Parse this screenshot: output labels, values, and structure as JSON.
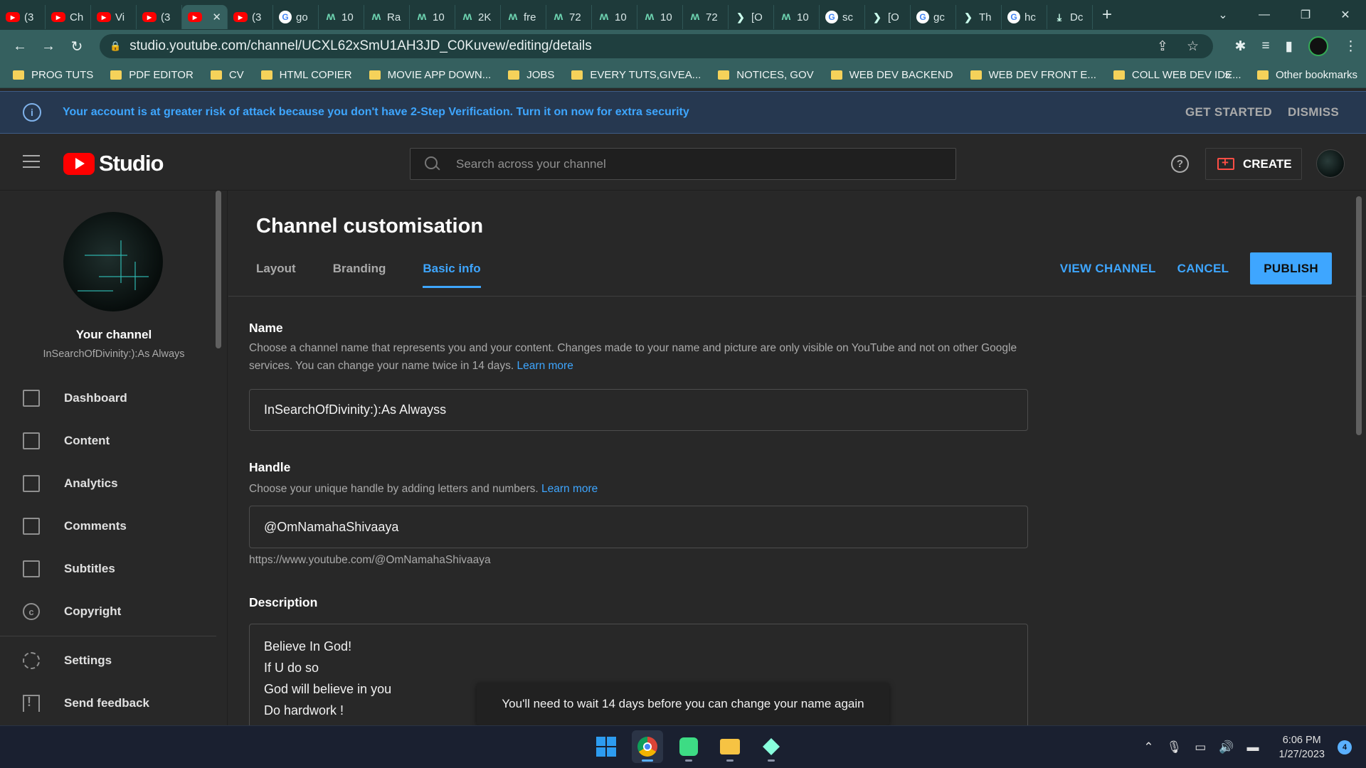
{
  "browser": {
    "tabs": [
      {
        "icon": "youtube-icon",
        "title": "(3"
      },
      {
        "icon": "youtube-icon",
        "title": "Ch"
      },
      {
        "icon": "youtube-icon",
        "title": "Vi"
      },
      {
        "icon": "youtube-icon",
        "title": "(3"
      },
      {
        "icon": "youtube-icon",
        "title": "",
        "active": true
      },
      {
        "icon": "youtube-icon",
        "title": "(3"
      },
      {
        "icon": "google-icon",
        "title": "go"
      },
      {
        "icon": "mooc-icon",
        "title": "10"
      },
      {
        "icon": "mooc-icon",
        "title": "Ra"
      },
      {
        "icon": "mooc-icon",
        "title": "10"
      },
      {
        "icon": "mooc-icon",
        "title": "2K"
      },
      {
        "icon": "mooc-icon",
        "title": "fre"
      },
      {
        "icon": "mooc-icon",
        "title": "72"
      },
      {
        "icon": "mooc-icon",
        "title": "10"
      },
      {
        "icon": "mooc-icon",
        "title": "10"
      },
      {
        "icon": "mooc-icon",
        "title": "72"
      },
      {
        "icon": "arrow-icon",
        "title": "[O"
      },
      {
        "icon": "mooc-icon",
        "title": "10"
      },
      {
        "icon": "google-icon",
        "title": "sc"
      },
      {
        "icon": "arrow-icon",
        "title": "[O"
      },
      {
        "icon": "google-icon",
        "title": "gc"
      },
      {
        "icon": "arrow-icon",
        "title": "Th"
      },
      {
        "icon": "google-icon",
        "title": "hc"
      },
      {
        "icon": "download-icon",
        "title": "Dc"
      }
    ],
    "url": "studio.youtube.com/channel/UCXL62xSmU1AH3JD_C0Kuvew/editing/details",
    "bookmarks": [
      "PROG TUTS",
      "PDF EDITOR",
      "CV",
      "HTML COPIER",
      "MOVIE APP DOWN...",
      "JOBS",
      "EVERY TUTS,GIVEA...",
      "NOTICES, GOV",
      "WEB DEV BACKEND",
      "WEB DEV FRONT E...",
      "COLL WEB DEV IDE..."
    ],
    "bookmarks_more": "»",
    "other_bookmarks": "Other bookmarks"
  },
  "banner": {
    "message": "Your account is at greater risk of attack because you don't have 2-Step Verification. Turn it on now for extra security",
    "get_started": "GET STARTED",
    "dismiss": "DISMISS"
  },
  "header": {
    "logo_text": "Studio",
    "search_placeholder": "Search across your channel",
    "create_label": "CREATE"
  },
  "sidebar": {
    "your_channel": "Your channel",
    "channel_name": "InSearchOfDivinity:):As Always",
    "items": [
      {
        "label": "Dashboard",
        "icon": "dashboard-icon"
      },
      {
        "label": "Content",
        "icon": "content-icon"
      },
      {
        "label": "Analytics",
        "icon": "analytics-icon"
      },
      {
        "label": "Comments",
        "icon": "comments-icon"
      },
      {
        "label": "Subtitles",
        "icon": "subtitles-icon"
      },
      {
        "label": "Copyright",
        "icon": "copyright-icon"
      },
      {
        "label": "Settings",
        "icon": "settings-icon"
      },
      {
        "label": "Send feedback",
        "icon": "feedback-icon"
      }
    ]
  },
  "main": {
    "title": "Channel customisation",
    "tabs": [
      {
        "label": "Layout"
      },
      {
        "label": "Branding"
      },
      {
        "label": "Basic info",
        "active": true
      }
    ],
    "view_channel": "VIEW CHANNEL",
    "cancel": "CANCEL",
    "publish": "PUBLISH",
    "name": {
      "title": "Name",
      "description": "Choose a channel name that represents you and your content. Changes made to your name and picture are only visible on YouTube and not on other Google services. You can change your name twice in 14 days.",
      "learn_more": "Learn more",
      "value": "InSearchOfDivinity:):As Alwayss"
    },
    "handle": {
      "title": "Handle",
      "description": "Choose your unique handle by adding letters and numbers.",
      "learn_more": "Learn more",
      "value": "@OmNamahaShivaaya",
      "url": "https://www.youtube.com/@OmNamahaShivaaya"
    },
    "description": {
      "title": "Description",
      "lines": [
        "Believe In God!",
        "If U do so",
        "God will believe in you",
        "Do hardwork  !"
      ]
    },
    "toast": "You'll need to wait 14 days before you can change your name again"
  },
  "taskbar": {
    "apps": [
      "windows-start-icon",
      "chrome-icon",
      "android-studio-icon",
      "file-explorer-icon",
      "app-icon"
    ],
    "time": "6:06 PM",
    "date": "1/27/2023",
    "notification_count": "4"
  }
}
